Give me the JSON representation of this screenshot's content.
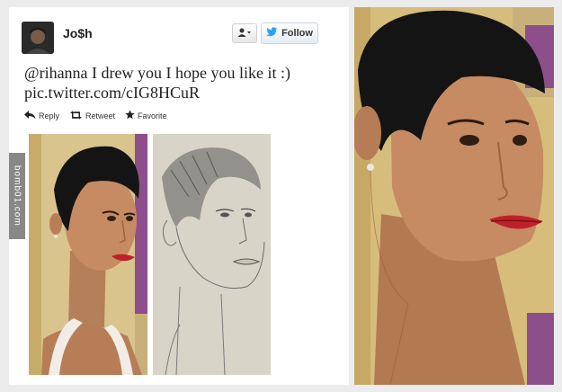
{
  "tweet": {
    "display_name": "Jo$h",
    "text_line1": "@rihanna I drew you I hope you like it :)",
    "text_line2": "pic.twitter.com/cIG8HCuR",
    "actions": {
      "reply": "Reply",
      "retweet": "Retweet",
      "favorite": "Favorite"
    },
    "follow_label": "Follow"
  },
  "watermark": "bomb01.com",
  "icons": [
    "user-dropdown-icon",
    "twitter-bird-icon",
    "reply-icon",
    "retweet-icon",
    "favorite-star-icon"
  ],
  "colors": {
    "twitter_blue": "#2aa3ef",
    "lipstick": "#c0202a",
    "mtv_purple": "#7a3f8f"
  }
}
